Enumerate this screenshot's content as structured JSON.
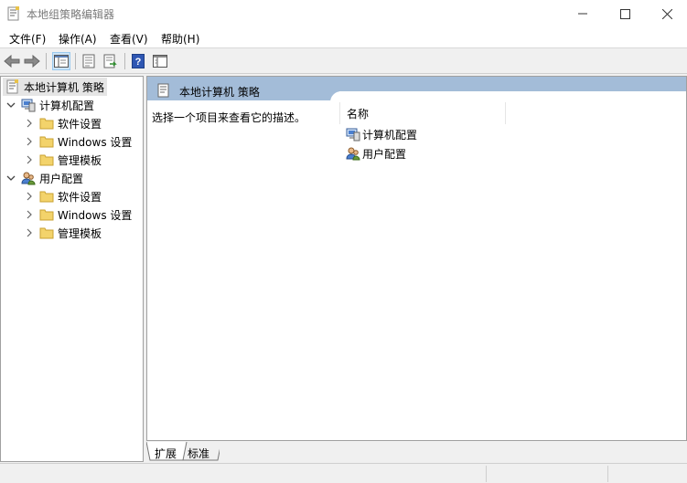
{
  "window": {
    "title": "本地组策略编辑器",
    "minimize_icon": "minimize-icon",
    "maximize_icon": "maximize-icon",
    "close_icon": "close-icon"
  },
  "menu": {
    "items": [
      {
        "label": "文件(F)"
      },
      {
        "label": "操作(A)"
      },
      {
        "label": "查看(V)"
      },
      {
        "label": "帮助(H)"
      }
    ]
  },
  "toolbar": {
    "buttons": [
      "back-arrow-icon",
      "forward-arrow-icon",
      "show-tree-icon",
      "properties-icon",
      "export-list-icon",
      "help-icon",
      "console-icon"
    ]
  },
  "tree": {
    "root": {
      "label": "本地计算机 策略",
      "icon": "policy-document-icon"
    },
    "nodes": [
      {
        "label": "计算机配置",
        "icon": "computer-icon",
        "expanded": true,
        "children": [
          {
            "label": "软件设置",
            "icon": "folder-icon"
          },
          {
            "label": "Windows 设置",
            "icon": "folder-icon"
          },
          {
            "label": "管理模板",
            "icon": "folder-icon"
          }
        ]
      },
      {
        "label": "用户配置",
        "icon": "users-icon",
        "expanded": true,
        "children": [
          {
            "label": "软件设置",
            "icon": "folder-icon"
          },
          {
            "label": "Windows 设置",
            "icon": "folder-icon"
          },
          {
            "label": "管理模板",
            "icon": "folder-icon"
          }
        ]
      }
    ]
  },
  "details": {
    "header_title": "本地计算机 策略",
    "description": "选择一个项目来查看它的描述。",
    "column_name": "名称",
    "items": [
      {
        "label": "计算机配置",
        "icon": "computer-icon"
      },
      {
        "label": "用户配置",
        "icon": "users-icon"
      }
    ]
  },
  "tabs": {
    "extended": "扩展",
    "standard": "标准"
  },
  "colors": {
    "header_band": "#a3bcd8",
    "folder": "#e8c24a",
    "selected_bg": "#e5e5e5"
  }
}
